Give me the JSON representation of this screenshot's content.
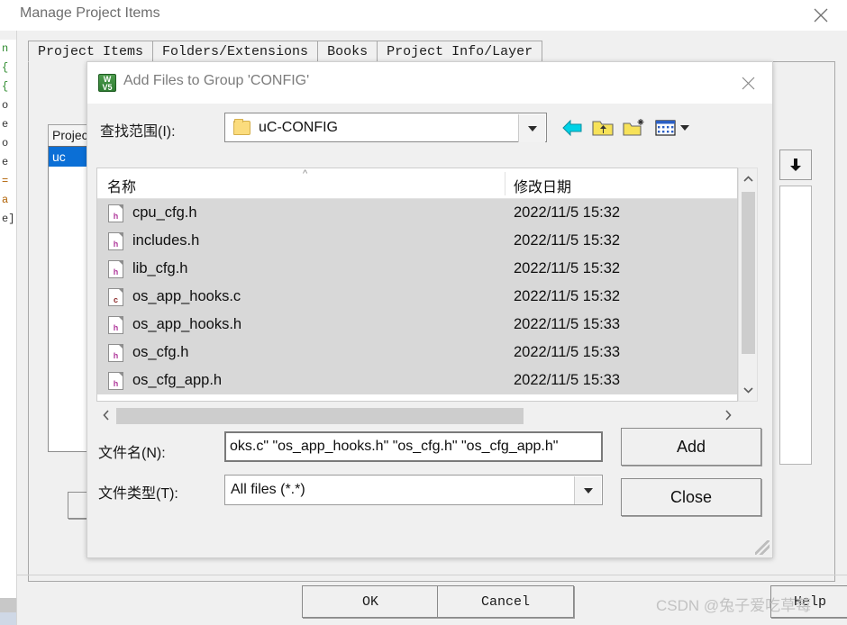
{
  "main_window": {
    "title": "Manage Project Items",
    "close_icon": "close-icon",
    "tabs": [
      {
        "label": "Project Items",
        "active": true
      },
      {
        "label": "Folders/Extensions",
        "active": false
      },
      {
        "label": "Books",
        "active": false
      },
      {
        "label": "Project Info/Layer",
        "active": false
      }
    ],
    "project_list_header": "Projec",
    "project_list_selected": "uc",
    "buttons": {
      "ok": "OK",
      "cancel": "Cancel",
      "help": "Help"
    },
    "right_arrow_icon": "move-down-icon"
  },
  "dialog": {
    "title": "Add Files to Group 'CONFIG'",
    "app_icon_top": "W",
    "app_icon_bottom": "V5",
    "close_icon": "close-icon",
    "look_in": {
      "label": "查找范围(I):",
      "value": "uC-CONFIG",
      "folder_icon": "folder-icon",
      "dropdown_icon": "chevron-down-icon"
    },
    "toolbar": [
      {
        "name": "back-icon",
        "title": "Back"
      },
      {
        "name": "up-folder-icon",
        "title": "Up one level"
      },
      {
        "name": "new-folder-icon",
        "title": "New folder"
      },
      {
        "name": "view-mode-icon",
        "title": "Views"
      }
    ],
    "file_list": {
      "columns": [
        "名称",
        "修改日期"
      ],
      "sort_indicator": "sort-ascending-icon",
      "rows": [
        {
          "icon": "file-h-icon",
          "badge": "h",
          "name": "cpu_cfg.h",
          "date": "2022/11/5 15:32",
          "selected": true
        },
        {
          "icon": "file-h-icon",
          "badge": "h",
          "name": "includes.h",
          "date": "2022/11/5 15:32",
          "selected": true
        },
        {
          "icon": "file-h-icon",
          "badge": "h",
          "name": "lib_cfg.h",
          "date": "2022/11/5 15:32",
          "selected": true
        },
        {
          "icon": "file-c-icon",
          "badge": "c",
          "name": "os_app_hooks.c",
          "date": "2022/11/5 15:32",
          "selected": true
        },
        {
          "icon": "file-h-icon",
          "badge": "h",
          "name": "os_app_hooks.h",
          "date": "2022/11/5 15:33",
          "selected": true
        },
        {
          "icon": "file-h-icon",
          "badge": "h",
          "name": "os_cfg.h",
          "date": "2022/11/5 15:33",
          "selected": true
        },
        {
          "icon": "file-h-icon",
          "badge": "h",
          "name": "os_cfg_app.h",
          "date": "2022/11/5 15:33",
          "selected": true
        }
      ],
      "vscroll_up_icon": "chevron-up-icon",
      "vscroll_down_icon": "chevron-down-icon",
      "hscroll_left_icon": "chevron-left-icon",
      "hscroll_right_icon": "chevron-right-icon"
    },
    "file_name": {
      "label": "文件名(N):",
      "value": "oks.c\" \"os_app_hooks.h\" \"os_cfg.h\" \"os_cfg_app.h\"",
      "placeholder": ""
    },
    "file_type": {
      "label": "文件类型(T):",
      "value": "All files (*.*)",
      "dropdown_icon": "chevron-down-icon"
    },
    "buttons": {
      "add": "Add",
      "close": "Close"
    },
    "resize_grip": "resize-grip-icon"
  },
  "watermark": {
    "text": "CSDN @兔子爱吃草莓"
  },
  "background_code": {
    "lines": [
      "n",
      "",
      "",
      "",
      "{",
      "",
      "{",
      "o",
      "e",
      "o",
      "e",
      "",
      "",
      "",
      "",
      "",
      "=",
      "a",
      "",
      "e]"
    ]
  },
  "colors": {
    "selection_blue": "#0b6fd6",
    "row_selected": "#d8d8d8",
    "dialog_bg": "#f0f0f0",
    "folder_yellow": "#fbdc7d",
    "accent_cyan": "#00d2e6"
  }
}
